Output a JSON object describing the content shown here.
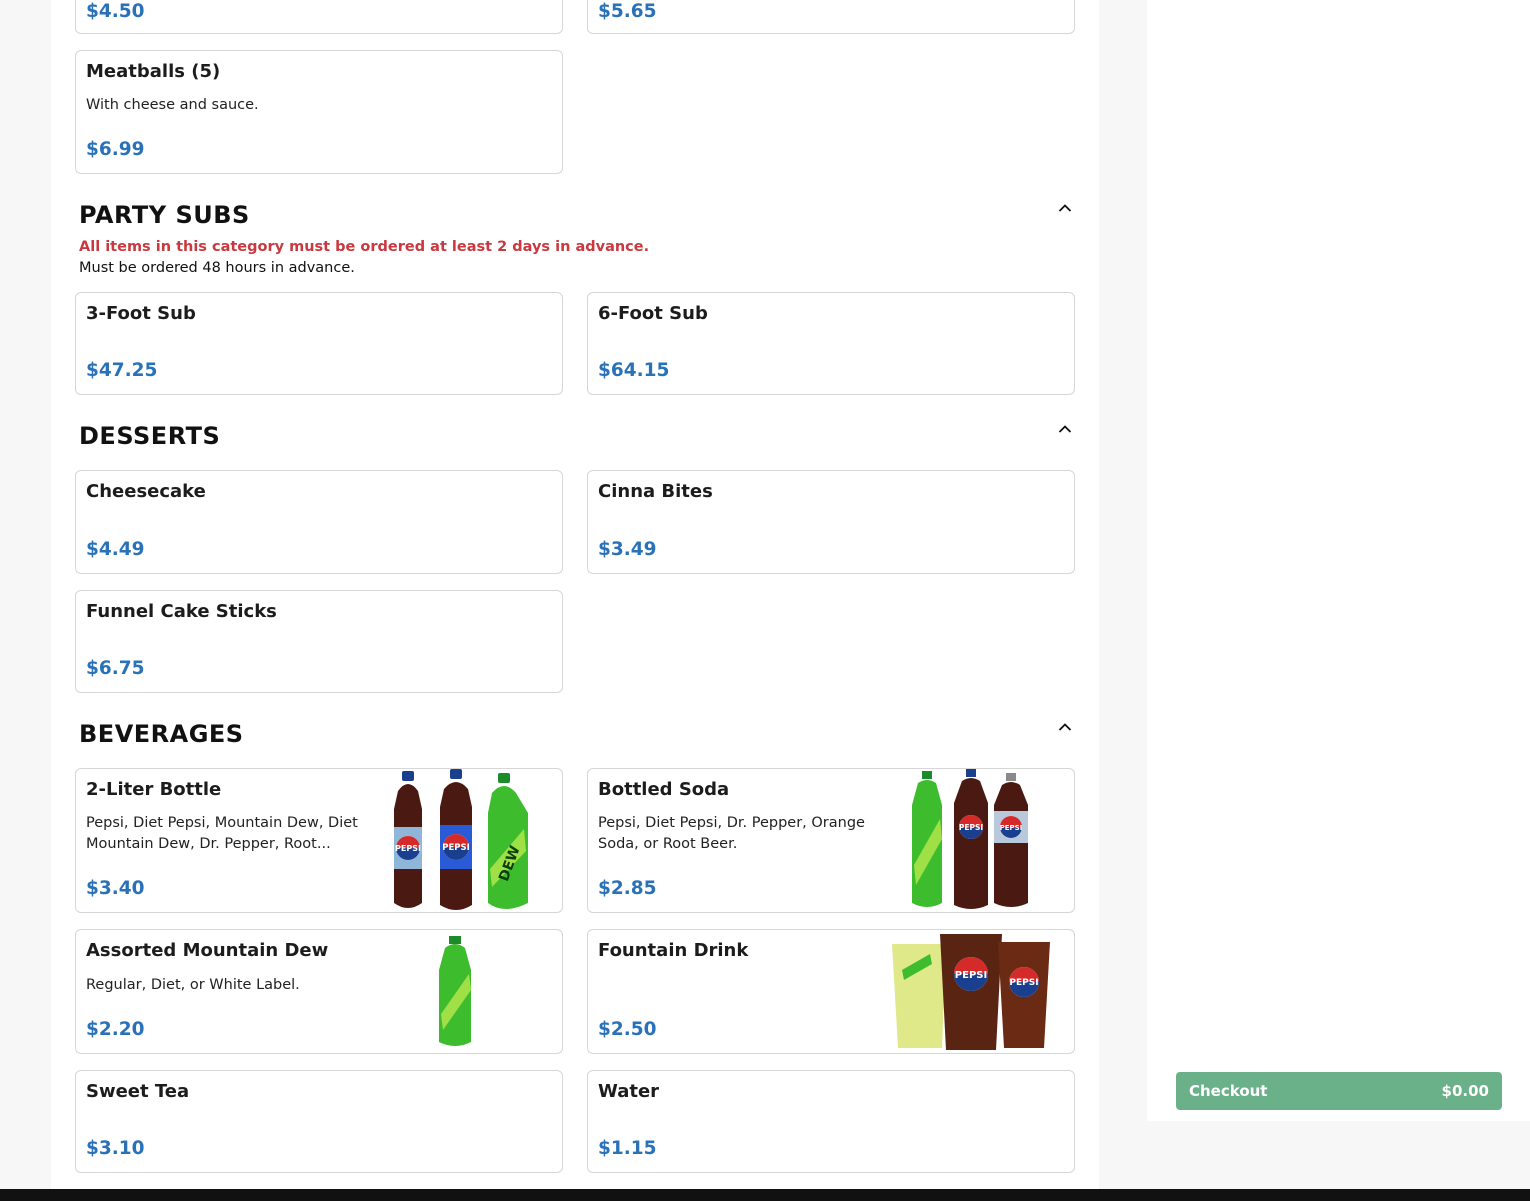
{
  "colors": {
    "price": "#2a72b8",
    "warning": "#c9393f",
    "checkout": "#6ab18a"
  },
  "top_cards": {
    "left_price": "$4.50",
    "right_price": "$5.65"
  },
  "meatballs": {
    "name": "Meatballs (5)",
    "description": "With cheese and sauce.",
    "price": "$6.99"
  },
  "party_subs": {
    "title": "PARTY SUBS",
    "warning": "All items in this category must be ordered at least 2 days in advance.",
    "note": "Must be ordered 48 hours in advance.",
    "items": [
      {
        "name": "3-Foot Sub",
        "price": "$47.25"
      },
      {
        "name": "6-Foot Sub",
        "price": "$64.15"
      }
    ]
  },
  "desserts": {
    "title": "DESSERTS",
    "items": [
      {
        "name": "Cheesecake",
        "price": "$4.49"
      },
      {
        "name": "Cinna Bites",
        "price": "$3.49"
      },
      {
        "name": "Funnel Cake Sticks",
        "price": "$6.75"
      }
    ]
  },
  "beverages": {
    "title": "BEVERAGES",
    "items": [
      {
        "name": "2-Liter Bottle",
        "description": "Pepsi, Diet Pepsi, Mountain Dew, Diet Mountain Dew, Dr. Pepper, Root...",
        "price": "$3.40",
        "image": "two-liter-bottles-image"
      },
      {
        "name": "Bottled Soda",
        "description": "Pepsi, Diet Pepsi, Dr. Pepper, Orange Soda, or Root Beer.",
        "price": "$2.85",
        "image": "bottled-soda-image"
      },
      {
        "name": "Assorted Mountain Dew",
        "description": "Regular, Diet, or White Label.",
        "price": "$2.20",
        "image": "mountain-dew-bottle-image"
      },
      {
        "name": "Fountain Drink",
        "price": "$2.50",
        "image": "fountain-drinks-image"
      },
      {
        "name": "Sweet Tea",
        "price": "$3.10"
      },
      {
        "name": "Water",
        "price": "$1.15"
      }
    ]
  },
  "checkout": {
    "label": "Checkout",
    "total": "$0.00"
  }
}
